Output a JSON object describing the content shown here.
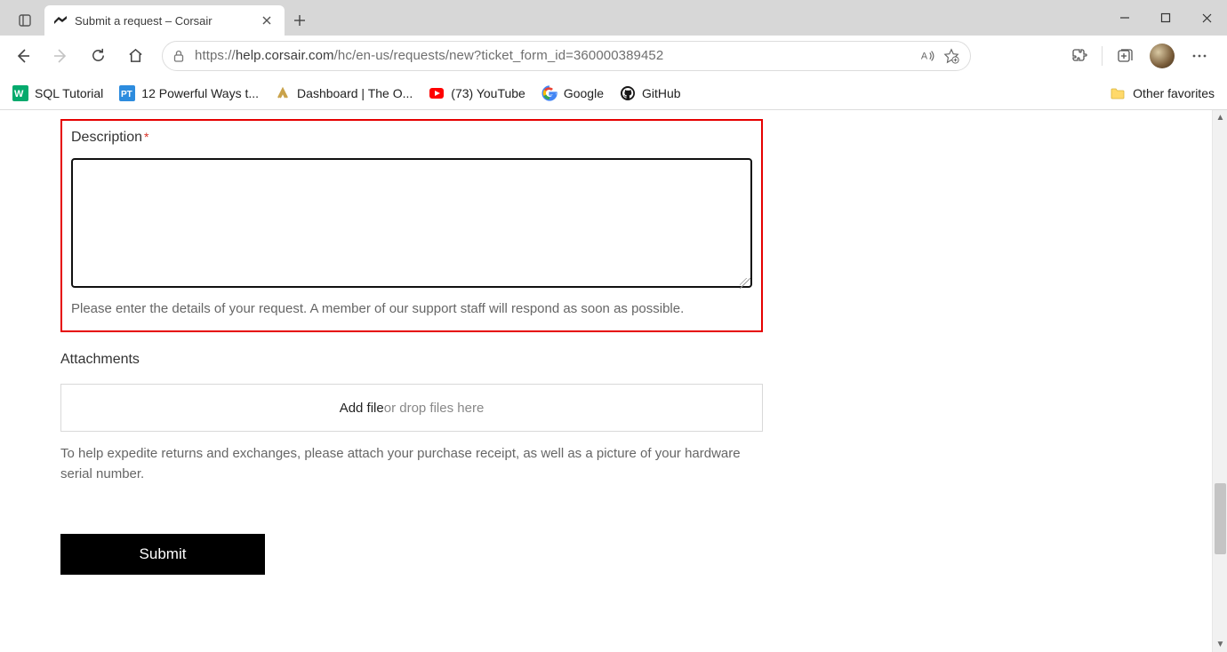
{
  "window": {
    "tab_title": "Submit a request – Corsair"
  },
  "toolbar": {
    "url_scheme": "https://",
    "url_host": "help.corsair.com",
    "url_path": "/hc/en-us/requests/new?ticket_form_id=360000389452"
  },
  "bookmarks": {
    "b0": "SQL Tutorial",
    "b1": "12 Powerful Ways t...",
    "b2": "Dashboard | The O...",
    "b3": "(73) YouTube",
    "b4": "Google",
    "b5": "GitHub",
    "other": "Other favorites"
  },
  "form": {
    "description_label": "Description",
    "description_help": "Please enter the details of your request. A member of our support staff will respond as soon as possible.",
    "attachments_label": "Attachments",
    "addfile_label": "Add file",
    "ordrop_label": " or drop files here",
    "attachments_help": "To help expedite returns and exchanges, please attach your purchase receipt, as well as a picture of your hardware serial number.",
    "submit_label": "Submit"
  }
}
